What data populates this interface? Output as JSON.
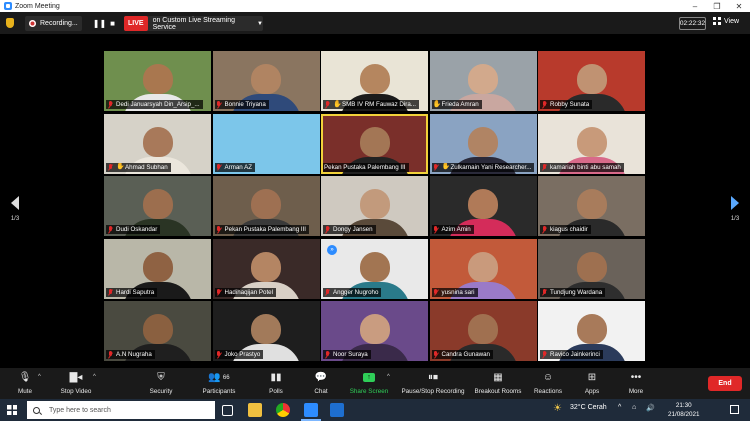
{
  "window": {
    "title": "Zoom Meeting",
    "controls": [
      "–",
      "❐",
      "✕"
    ]
  },
  "topbar": {
    "recording_label": "Recording...",
    "live_badge": "LIVE",
    "live_service": "on Custom Live Streaming Service",
    "timer": "02:22:32",
    "view_label": "View"
  },
  "gallery": {
    "page_indicator_left": "1/3",
    "page_indicator_right": "1/3",
    "tiles": [
      {
        "name": "Dedi Januarsyah Din_Arsip_...",
        "muted": true,
        "bg": "#6f8f4e",
        "face": "#a9774f",
        "shirt": "#e8e8e8"
      },
      {
        "name": "Bonnie Triyana",
        "muted": true,
        "bg": "#8a7560",
        "face": "#b08462",
        "shirt": "#2f4a7a"
      },
      {
        "name": "SMB IV RM Fauwaz Dira...",
        "muted": true,
        "raised_hand": true,
        "bg": "#e9e4d6",
        "face": "#b5865f",
        "shirt": "#1b1b1b"
      },
      {
        "name": "Frieda Amran",
        "muted": false,
        "raised_hand": true,
        "bg": "#9aa2a8",
        "face": "#d2a98c",
        "shirt": "#c9a7a0"
      },
      {
        "name": "Robby Sunata",
        "muted": true,
        "bg": "#b83a2c",
        "face": "#c09272",
        "shirt": "#2a2a2a"
      },
      {
        "name": "Ahmad Subhan",
        "muted": true,
        "raised_hand": true,
        "bg": "#d6d2c8",
        "face": "#a8795a",
        "shirt": "#ebe6dc"
      },
      {
        "name": "Arman AZ",
        "muted": true,
        "bg": "#7cc6ea",
        "face": null,
        "shirt": null
      },
      {
        "name": "Pekan Pustaka Palembang III",
        "muted": false,
        "active": true,
        "bg": "#7a2f2a",
        "face": "#a37655",
        "shirt": "#222"
      },
      {
        "name": "Zulkarnain Yani Researcher...",
        "muted": true,
        "raised_hand": true,
        "bg": "#8aa3c2",
        "face": "#b08464",
        "shirt": "#2a2a3a"
      },
      {
        "name": "kamariah binti abu samah",
        "muted": true,
        "bg": "#e9e3d9",
        "face": "#c89a7a",
        "shirt": "#d86a8a"
      },
      {
        "name": "Dudi Oskandar",
        "muted": true,
        "bg": "#5a5f55",
        "face": "#9c6e4e",
        "shirt": "#2a3424"
      },
      {
        "name": "Pekan Pustaka Palembang III",
        "muted": true,
        "bg": "#6e5e4c",
        "face": "#9e7052",
        "shirt": "#3a3a3a"
      },
      {
        "name": "Dongy Jansen",
        "muted": true,
        "bg": "#cfc9c0",
        "face": "#c29a7c",
        "shirt": "#5a4a3a"
      },
      {
        "name": "Azim Amin",
        "muted": true,
        "bg": "#2a2a2a",
        "face": "#b07a58",
        "shirt": "#d42c5a"
      },
      {
        "name": "kiagus chaidir",
        "muted": true,
        "bg": "#7a6e62",
        "face": "#a87c5c",
        "shirt": "#2a2a2a"
      },
      {
        "name": "Hardi Saputra",
        "muted": true,
        "bg": "#b9b7a8",
        "face": "#8f6243",
        "shirt": "#1a1a1a"
      },
      {
        "name": "Hadihaqijan Potel",
        "muted": true,
        "bg": "#3a2a28",
        "face": "#b48563",
        "shirt": "#d8d0c6"
      },
      {
        "name": "Angger Nugroho",
        "muted": true,
        "bg": "#e9e9e9",
        "face": "#a27552",
        "shirt": "#2a7a8a",
        "cc": true
      },
      {
        "name": "yusnina sari",
        "muted": true,
        "bg": "#c25a3a",
        "face": "#c99a7c",
        "shirt": "#9a7ac8"
      },
      {
        "name": "Tundjung Wardana",
        "muted": true,
        "bg": "#6a625a",
        "face": "#9e7050",
        "shirt": "#2e2e2e"
      },
      {
        "name": "A.N Nugraha",
        "muted": true,
        "bg": "#4a4a40",
        "face": "#8a6040",
        "shirt": "#1f1f1f"
      },
      {
        "name": "Joko Prastyo",
        "muted": true,
        "bg": "#1e1e1e",
        "face": "#a27a5a",
        "shirt": "#e0e0e0"
      },
      {
        "name": "Noor Suraya",
        "muted": true,
        "bg": "#6a4a8a",
        "face": "#c99c80",
        "shirt": "#3a2a4a"
      },
      {
        "name": "Candra Gunawan",
        "muted": true,
        "bg": "#8a3a2a",
        "face": "#a07050",
        "shirt": "#2a2a2a"
      },
      {
        "name": "Ravico Jainkerinci",
        "muted": true,
        "bg": "#f2f2f2",
        "face": "#a87a5a",
        "shirt": "#2b3b5b"
      }
    ]
  },
  "toolbar": {
    "mute": "Mute",
    "stop_video": "Stop Video",
    "security": "Security",
    "participants": "Participants",
    "participants_count": "66",
    "polls": "Polls",
    "chat": "Chat",
    "share_screen": "Share Screen",
    "pause_recording": "Pause/Stop Recording",
    "breakout_rooms": "Breakout Rooms",
    "reactions": "Reactions",
    "apps": "Apps",
    "more": "More",
    "end": "End"
  },
  "taskbar": {
    "search_placeholder": "Type here to search",
    "weather": "32°C  Cerah",
    "time": "21:30",
    "date": "21/08/2021"
  }
}
